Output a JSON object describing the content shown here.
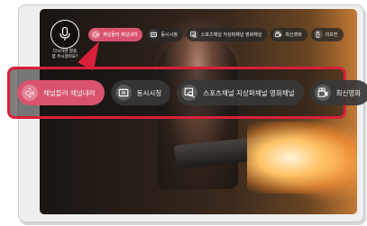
{
  "voice": {
    "hint_line1": "다시하면 말을",
    "hint_line2": "쯤 주시겠어요?"
  },
  "suggestions": [
    {
      "label": "채널들려 채널내려",
      "icon": "channel-icon",
      "active": true
    },
    {
      "label": "동시시청",
      "icon": "multiview-icon",
      "active": false
    },
    {
      "label": "스포츠채널 지상파채널 영화채널",
      "icon": "search-tv-icon",
      "active": false
    },
    {
      "label": "최신영화",
      "icon": "movie-icon",
      "active": false
    },
    {
      "label": "리모컨",
      "icon": "remote-icon",
      "active": false
    }
  ],
  "colors": {
    "accent": "#d9536e",
    "highlight_border": "#d8203a",
    "chip_bg": "#373737"
  }
}
